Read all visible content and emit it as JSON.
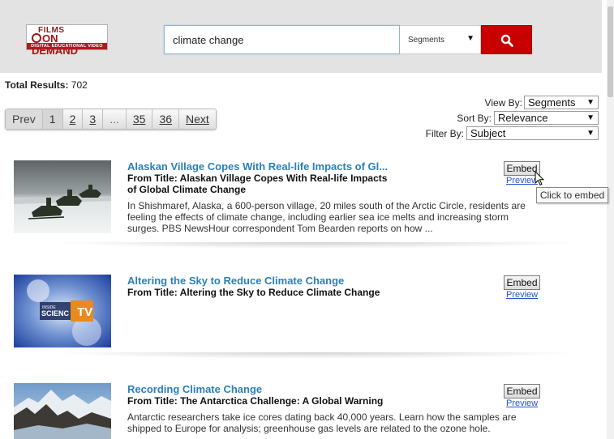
{
  "header": {
    "logo": {
      "line1": "FILMS",
      "line2": "ON DEMAND",
      "line3": "DIGITAL EDUCATIONAL VIDEO"
    },
    "search": {
      "value": "climate change",
      "placeholder": ""
    },
    "scope_select": {
      "selected": "Segments"
    },
    "search_button_icon": "search-icon"
  },
  "total_results": {
    "label": "Total Results:",
    "count": "702"
  },
  "pagination": [
    "Prev",
    "1",
    "2",
    "3",
    "...",
    "35",
    "36",
    "Next"
  ],
  "controls": {
    "view_by": {
      "label": "View By:",
      "value": "Segments"
    },
    "sort_by": {
      "label": "Sort By:",
      "value": "Relevance"
    },
    "filter_by": {
      "label": "Filter By:",
      "value": "Subject"
    }
  },
  "results": [
    {
      "title": "Alaskan Village Copes With Real-life Impacts of Gl...",
      "from_title": "From Title: Alaskan Village Copes With Real-life Impacts of Global Climate Change",
      "description": "In Shishmaref, Alaska, a 600-person village, 20 miles south of the Arctic Circle, residents are feeling the effects of climate change, including earlier sea ice melts and increasing storm surges. PBS NewsHour correspondent Tom Bearden reports on how ...",
      "embed_label": "Embed",
      "preview_label": "Preview"
    },
    {
      "title": "Altering the Sky to Reduce Climate Change",
      "from_title": "From Title: Altering the Sky to Reduce Climate Change",
      "description": "",
      "embed_label": "Embed",
      "preview_label": "Preview",
      "thumb_text": "INSIDE SCIENCE TV"
    },
    {
      "title": "Recording Climate Change",
      "from_title": "From Title: The Antarctica Challenge: A Global Warning",
      "description": "Antarctic researchers take ice cores dating back 40,000 years. Learn how the samples are shipped to Europe for analysis; greenhouse gas levels are related to the ozone hole.",
      "embed_label": "Embed",
      "preview_label": "Preview"
    }
  ],
  "tooltip": "Click to embed",
  "colors": {
    "accent": "#c90000",
    "link": "#2a80b9",
    "header_bg": "#e3e3e3"
  }
}
